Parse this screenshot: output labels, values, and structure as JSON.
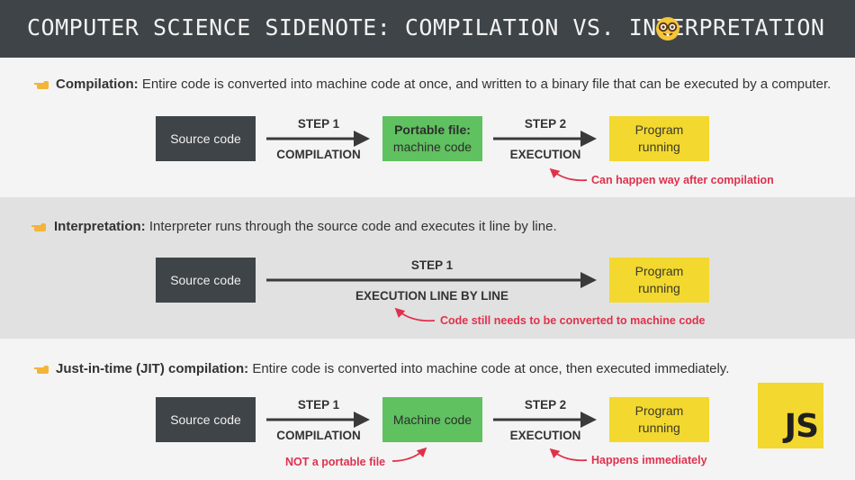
{
  "header": {
    "title": "COMPUTER SCIENCE SIDENOTE: COMPILATION VS. INTERPRETATION",
    "emoji_icon": "nerd-face-icon"
  },
  "compilation": {
    "term": "Compilation:",
    "description": " Entire code is converted into machine code at once, and written to a binary file that can be executed by a computer.",
    "source_box": "Source code",
    "step1_label": "STEP 1",
    "step1_action": "COMPILATION",
    "middle_box_line1": "Portable file:",
    "middle_box_line2": "machine code",
    "step2_label": "STEP 2",
    "step2_action": "EXECUTION",
    "result_line1": "Program",
    "result_line2": "running",
    "note": "Can happen way after compilation"
  },
  "interpretation": {
    "term": "Interpretation:",
    "description": " Interpreter runs through the source code and executes it line by line.",
    "source_box": "Source code",
    "step1_label": "STEP 1",
    "step1_action": "EXECUTION LINE BY LINE",
    "result_line1": "Program",
    "result_line2": "running",
    "note": "Code still needs to be converted to machine code"
  },
  "jit": {
    "term": "Just-in-time (JIT) compilation:",
    "description": " Entire code is converted into machine code at once, then executed immediately.",
    "source_box": "Source code",
    "step1_label": "STEP 1",
    "step1_action": "COMPILATION",
    "middle_box": "Machine code",
    "step2_label": "STEP 2",
    "step2_action": "EXECUTION",
    "result_line1": "Program",
    "result_line2": "running",
    "note_left": "NOT a portable file",
    "note_right": "Happens immediately"
  },
  "logo": {
    "text": "JS"
  },
  "colors": {
    "dark": "#3f4448",
    "green": "#5fc15f",
    "yellow": "#f3d82f",
    "note_red": "#e0314c",
    "band_gray": "#e1e1e1"
  }
}
